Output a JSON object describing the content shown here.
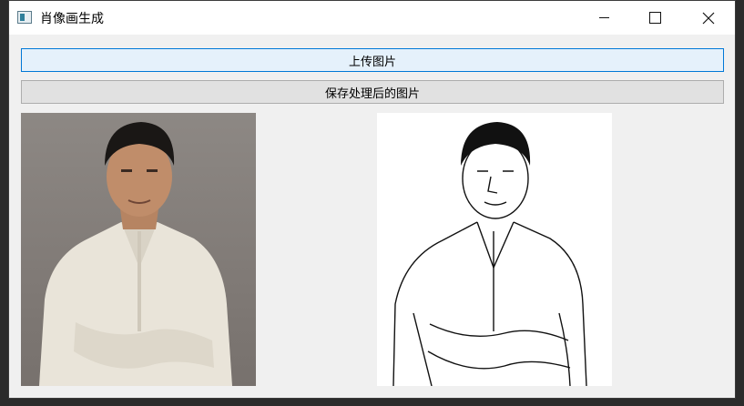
{
  "window": {
    "title": "肖像画生成",
    "icon": "app-window-icon",
    "controls": [
      "minimize-icon",
      "maximize-icon",
      "close-icon"
    ]
  },
  "buttons": {
    "upload_label": "上传图片",
    "save_label": "保存处理后的图片"
  },
  "images": {
    "original": "portrait-photo",
    "processed": "portrait-sketch"
  }
}
